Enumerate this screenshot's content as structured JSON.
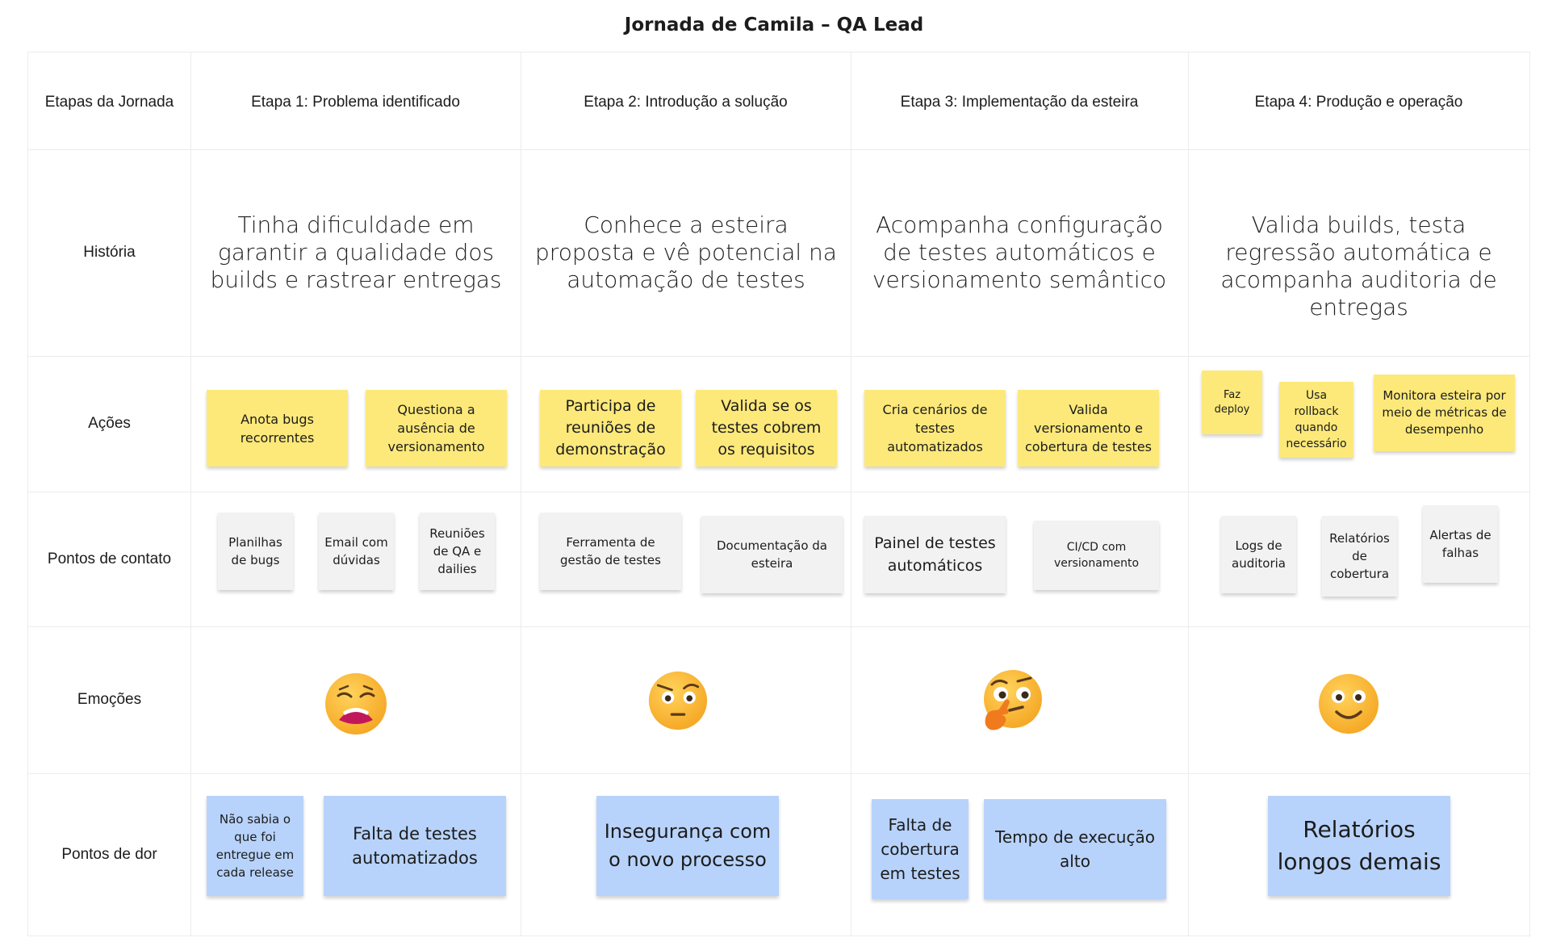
{
  "title": "Jornada de Camila – QA Lead",
  "colors": {
    "yellow": "#fce97a",
    "gray": "#f2f2f3",
    "blue": "#b8d3fb",
    "grid": "#ececec"
  },
  "row_labels": {
    "etapas": "Etapas da Jornada",
    "historia": "História",
    "acoes": "Ações",
    "pontos_contato": "Pontos de contato",
    "emocoes": "Emoções",
    "pontos_dor": "Pontos de dor"
  },
  "stages": [
    "Etapa 1: Problema identificado",
    "Etapa 2: Introdução a solução",
    "Etapa 3: Implementação da esteira",
    "Etapa 4: Produção e operação"
  ],
  "stories": [
    "Tinha dificuldade em garantir a qualidade dos builds e rastrear entregas",
    "Conhece a esteira proposta e vê potencial na automação de testes",
    "Acompanha configuração de testes automáticos e versionamento semântico",
    "Valida builds, testa regressão automática e acompanha auditoria de entregas"
  ],
  "actions": [
    [
      "Anota bugs recorrentes",
      "Questiona a ausência de versionamento"
    ],
    [
      "Participa de reuniões de demonstração",
      "Valida se os testes cobrem os requisitos"
    ],
    [
      "Cria cenários de testes automatizados",
      "Valida versionamento e cobertura de testes"
    ],
    [
      "Faz deploy",
      "Usa rollback quando necessário",
      "Monitora esteira por meio de métricas de desempenho"
    ]
  ],
  "touchpoints": [
    [
      "Planilhas de bugs",
      "Email com dúvidas",
      "Reuniões de QA e dailies"
    ],
    [
      "Ferramenta de gestão de testes",
      "Documentação da esteira"
    ],
    [
      "Painel de testes automáticos",
      "CI/CD com versionamento"
    ],
    [
      "Logs de auditoria",
      "Relatórios de cobertura",
      "Alertas de falhas"
    ]
  ],
  "emotions": [
    "weary-face-emoji",
    "raised-eyebrow-face-emoji",
    "thinking-face-emoji",
    "smiling-face-emoji"
  ],
  "pain_points": [
    [
      "Não sabia o que foi entregue em cada release",
      "Falta de testes automatizados"
    ],
    [
      "Insegurança com o novo processo"
    ],
    [
      "Falta de cobertura em testes",
      "Tempo de execução alto"
    ],
    [
      "Relatórios longos demais"
    ]
  ]
}
